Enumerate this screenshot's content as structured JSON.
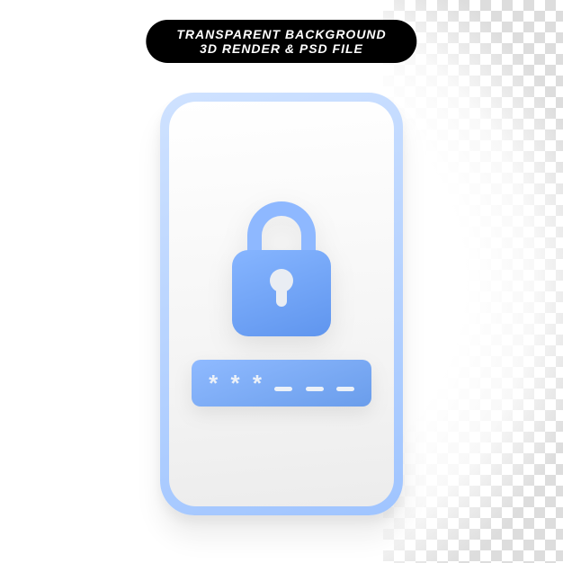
{
  "banner": {
    "line1": "TRANSPARENT BACKGROUND",
    "line2": "3D RENDER & PSD FILE"
  },
  "password": {
    "typed": [
      "*",
      "*",
      "*"
    ],
    "remaining_slots": 3
  },
  "colors": {
    "phone_frame": "#9fc4ff",
    "lock": "#6a9deb",
    "banner_bg": "#000000",
    "banner_text": "#ffffff"
  }
}
